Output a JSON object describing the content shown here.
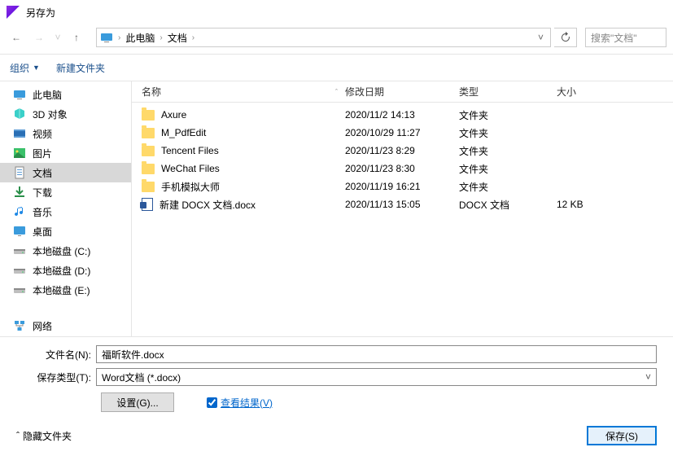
{
  "title": "另存为",
  "breadcrumbs": [
    "此电脑",
    "文档"
  ],
  "search_placeholder": "搜索\"文档\"",
  "toolbar": {
    "organize": "组织",
    "new_folder": "新建文件夹"
  },
  "sidebar": {
    "items": [
      {
        "label": "此电脑",
        "icon": "pc"
      },
      {
        "label": "3D 对象",
        "icon": "3d"
      },
      {
        "label": "视频",
        "icon": "video"
      },
      {
        "label": "图片",
        "icon": "picture"
      },
      {
        "label": "文档",
        "icon": "document",
        "selected": true
      },
      {
        "label": "下载",
        "icon": "download"
      },
      {
        "label": "音乐",
        "icon": "music"
      },
      {
        "label": "桌面",
        "icon": "desktop"
      },
      {
        "label": "本地磁盘 (C:)",
        "icon": "drive"
      },
      {
        "label": "本地磁盘 (D:)",
        "icon": "drive"
      },
      {
        "label": "本地磁盘 (E:)",
        "icon": "drive"
      },
      {
        "label": "网络",
        "icon": "network"
      }
    ]
  },
  "columns": {
    "name": "名称",
    "date": "修改日期",
    "type": "类型",
    "size": "大小"
  },
  "files": [
    {
      "name": "Axure",
      "date": "2020/11/2 14:13",
      "type": "文件夹",
      "size": "",
      "kind": "folder"
    },
    {
      "name": "M_PdfEdit",
      "date": "2020/10/29 11:27",
      "type": "文件夹",
      "size": "",
      "kind": "folder"
    },
    {
      "name": "Tencent Files",
      "date": "2020/11/23 8:29",
      "type": "文件夹",
      "size": "",
      "kind": "folder"
    },
    {
      "name": "WeChat Files",
      "date": "2020/11/23 8:30",
      "type": "文件夹",
      "size": "",
      "kind": "folder"
    },
    {
      "name": "手机模拟大师",
      "date": "2020/11/19 16:21",
      "type": "文件夹",
      "size": "",
      "kind": "folder"
    },
    {
      "name": "新建 DOCX 文档.docx",
      "date": "2020/11/13 15:05",
      "type": "DOCX 文档",
      "size": "12 KB",
      "kind": "docx"
    }
  ],
  "form": {
    "filename_label": "文件名(N):",
    "filename_value": "福昕软件.docx",
    "filetype_label": "保存类型(T):",
    "filetype_value": "Word文档 (*.docx)",
    "settings_button": "设置(G)...",
    "view_result_label": "查看结果(V)"
  },
  "footer": {
    "hide_folders": "隐藏文件夹",
    "save_button": "保存(S)"
  }
}
